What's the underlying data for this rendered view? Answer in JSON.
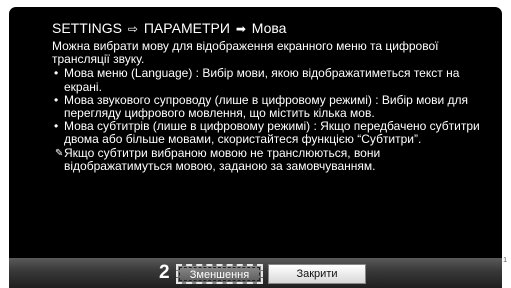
{
  "title": {
    "part1": "SETTINGS",
    "part2": "ПАРАМЕТРИ",
    "part3": "Мова"
  },
  "intro": "Можна вибрати мову для відображення екранного меню та цифрової трансляції звуку.",
  "bullets": [
    "Мова меню (Language) : Вибір мови, якою відображатиметься текст на екрані.",
    "Мова звукового супроводу (лише в цифровому режимі) : Вибір мови для перегляду цифрового мовлення, що містить кілька мов.",
    "Мова субтитрів (лише в цифровому режимі) : Якщо передбачено субтитри двома або більше мовами, скористайтеся функцією “Субтитри”."
  ],
  "note": "Якщо субтитри вибраною мовою не транслюються, вони відображатимуться мовою, заданою за замовчуванням.",
  "icons": {
    "title_arrow_1": "hollow-right-arrow-icon",
    "title_arrow_2": "solid-right-arrow-icon",
    "note_icon": "pencil-icon"
  },
  "footer": {
    "step_number": "2",
    "reduce_label": "Зменшення",
    "close_label": "Закрити"
  },
  "corner_mark": "1"
}
